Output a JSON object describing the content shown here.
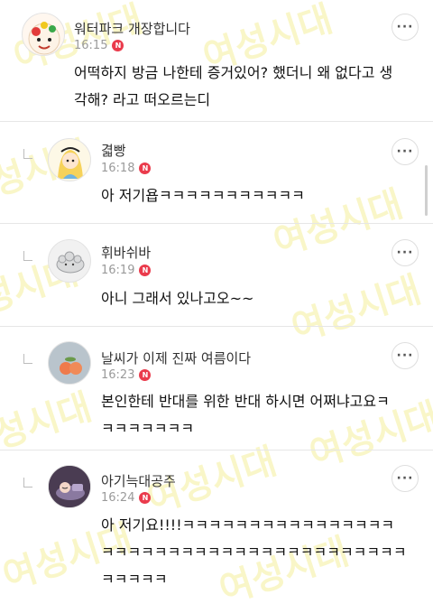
{
  "comments": [
    {
      "author": "워터파크 개장합니다",
      "time": "16:15",
      "badge": "N",
      "text": "어떡하지 방금 나한테 증거있어? 했더니 왜 없다고 생\n각해? 라고 떠오르는디",
      "is_reply": false,
      "avatar": "cream-character-avatar"
    },
    {
      "author": "겳빵",
      "time": "16:18",
      "badge": "N",
      "text": "아 저기욥ㅋㅋㅋㅋㅋㅋㅋㅋㅋㅋㅋ",
      "is_reply": true,
      "avatar": "alice-girl-avatar"
    },
    {
      "author": "휘바쉬바",
      "time": "16:19",
      "badge": "N",
      "text": "아니 그래서 있나고오~~",
      "is_reply": true,
      "avatar": "cloud-creature-avatar"
    },
    {
      "author": "날씨가 이제 진짜 여름이다",
      "time": "16:23",
      "badge": "N",
      "text": "본인한테 반대를 위한 반대 하시면 어쩌냐고요ㅋ\nㅋㅋㅋㅋㅋㅋㅋ",
      "is_reply": true,
      "avatar": "peach-fruit-avatar"
    },
    {
      "author": "아기늑대공주",
      "time": "16:24",
      "badge": "N",
      "text": "아 저기요!!!!ㅋㅋㅋㅋㅋㅋㅋㅋㅋㅋㅋㅋㅋㅋㅋㅋ\nㅋㅋㅋㅋㅋㅋㅋㅋㅋㅋㅋㅋㅋㅋㅋㅋㅋㅋㅋㅋㅋㅋㅋ\nㅋㅋㅋㅋㅋ",
      "is_reply": true,
      "avatar": "sleeping-character-avatar"
    }
  ],
  "more_button_label": "···",
  "watermark": "여성시대",
  "colors": {
    "badge": "#ea3b4c",
    "time": "#9a9a9a",
    "name": "#333333",
    "separator": "#e6e6e6"
  }
}
